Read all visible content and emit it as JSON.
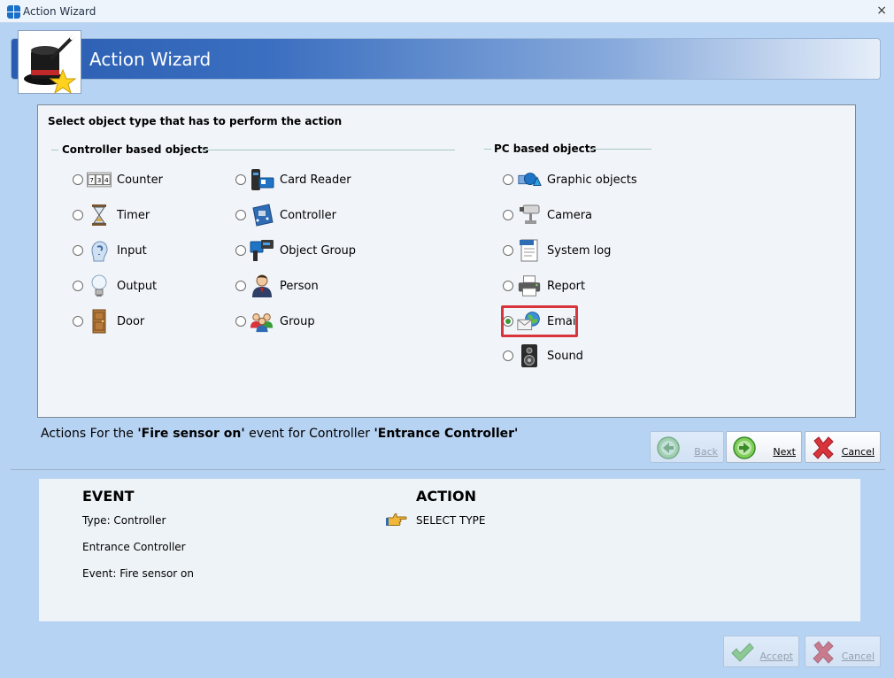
{
  "window": {
    "title": "Action Wizard",
    "close_glyph": "×"
  },
  "banner": {
    "title": "Action Wizard",
    "logo_icon": "magic-hat-icon"
  },
  "panel": {
    "title": "Select object type that has to perform the action",
    "controller_group": {
      "title": "Controller based objects",
      "items": [
        {
          "label": "Counter",
          "icon": "counter-icon"
        },
        {
          "label": "Timer",
          "icon": "hourglass-icon"
        },
        {
          "label": "Input",
          "icon": "input-icon"
        },
        {
          "label": "Output",
          "icon": "lightbulb-icon"
        },
        {
          "label": "Door",
          "icon": "door-icon"
        },
        {
          "label": "Card Reader",
          "icon": "card-reader-icon"
        },
        {
          "label": "Controller",
          "icon": "controller-board-icon"
        },
        {
          "label": "Object Group",
          "icon": "object-group-icon"
        },
        {
          "label": "Person",
          "icon": "person-icon"
        },
        {
          "label": "Group",
          "icon": "people-group-icon"
        }
      ]
    },
    "pc_group": {
      "title": "PC based objects",
      "items": [
        {
          "label": "Graphic objects",
          "icon": "graphic-objects-icon"
        },
        {
          "label": "Camera",
          "icon": "camera-icon"
        },
        {
          "label": "System log",
          "icon": "system-log-icon"
        },
        {
          "label": "Report",
          "icon": "printer-icon"
        },
        {
          "label": "Email",
          "icon": "email-icon",
          "selected": true
        },
        {
          "label": "Sound",
          "icon": "speaker-icon"
        }
      ]
    }
  },
  "info": {
    "prefix": "Actions  For the ",
    "event": "'Fire sensor on'",
    "middle": " event for Controller ",
    "controller": "'Entrance Controller'"
  },
  "nav_buttons": {
    "back": "Back",
    "next": "Next",
    "cancel": "Cancel"
  },
  "summary": {
    "event_heading": "EVENT",
    "event_type": "Type: Controller",
    "event_object": "Entrance Controller",
    "event_name": "Event: Fire sensor on",
    "action_heading": "ACTION",
    "action_text": "SELECT TYPE"
  },
  "bottom_buttons": {
    "accept": "Accept",
    "cancel": "Cancel"
  },
  "colors": {
    "window_bg": "#b7d3f3",
    "highlight": "#d9343c",
    "banner_start": "#2a5db1"
  }
}
